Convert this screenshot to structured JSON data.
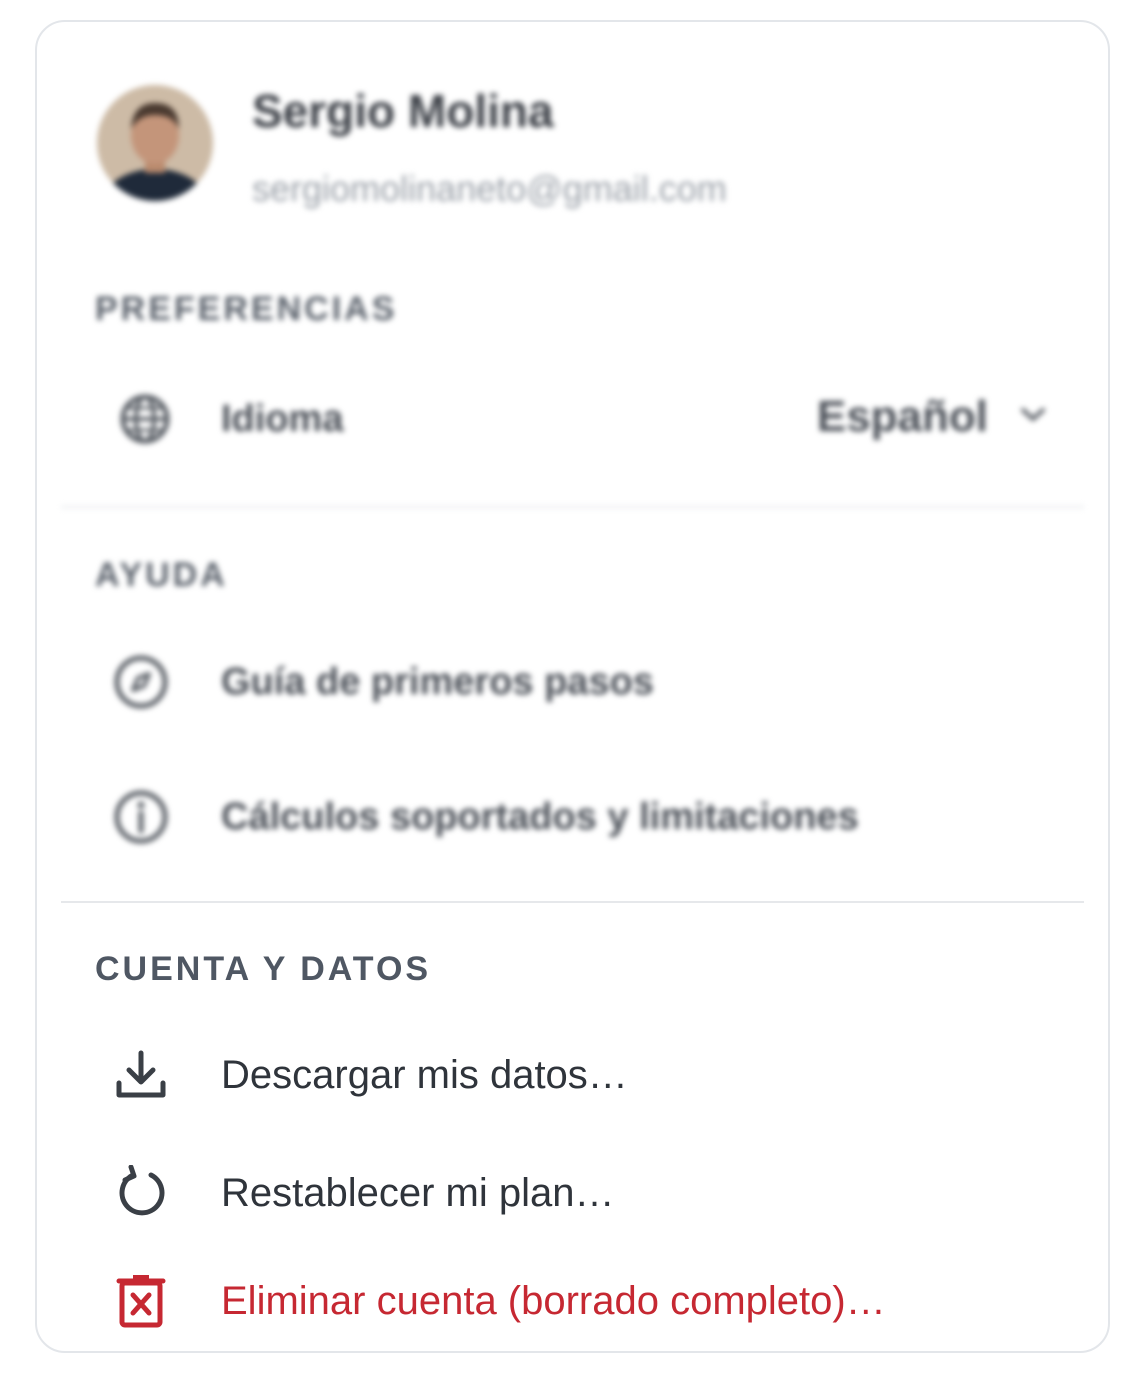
{
  "user": {
    "name": "Sergio Molina",
    "email": "sergiomolinaneto@gmail.com"
  },
  "preferences": {
    "title": "PREFERENCIAS",
    "language": {
      "label": "Idioma",
      "value": "Español",
      "icon": "globe-icon"
    }
  },
  "help": {
    "title": "AYUDA",
    "items": [
      {
        "label": "Guía de primeros pasos",
        "icon": "compass-icon"
      },
      {
        "label": "Cálculos soportados y limitaciones",
        "icon": "info-icon"
      }
    ]
  },
  "account": {
    "title": "CUENTA Y DATOS",
    "items": [
      {
        "label": "Descargar mis datos…",
        "icon": "download-icon"
      },
      {
        "label": "Restablecer mi plan…",
        "icon": "reset-icon"
      },
      {
        "label": "Eliminar cuenta (borrado completo)…",
        "icon": "delete-icon",
        "color": "#c62832"
      }
    ]
  },
  "colors": {
    "danger": "#c62832",
    "text": "#2f343b",
    "muted": "#5a616b"
  }
}
